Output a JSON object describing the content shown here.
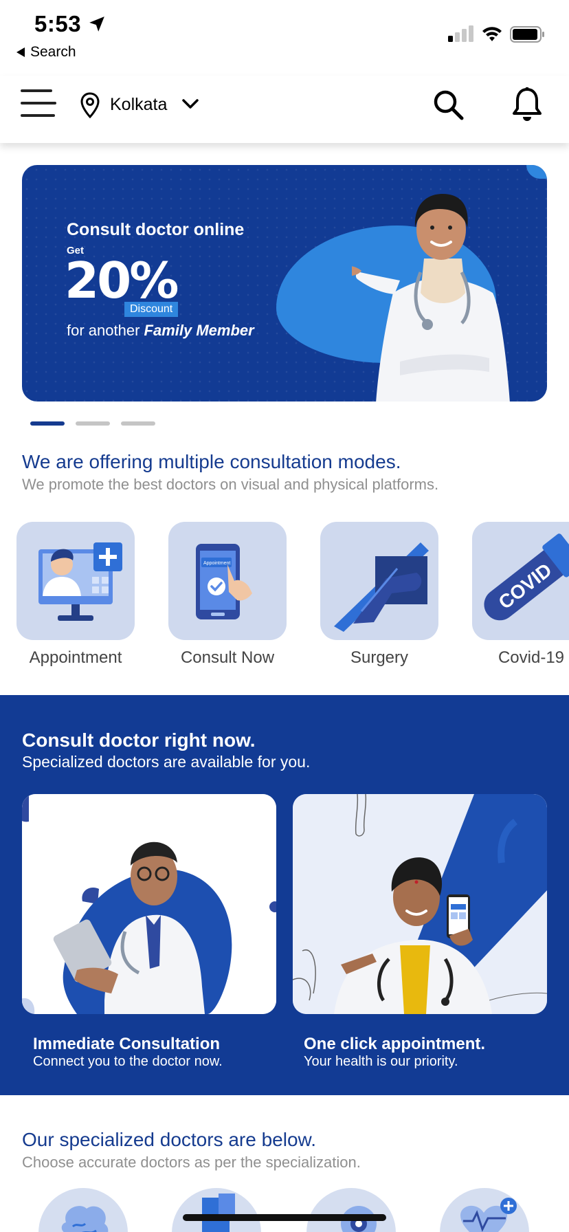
{
  "status_bar": {
    "time": "5:53",
    "back_label": "Search"
  },
  "header": {
    "location": "Kolkata"
  },
  "banner": {
    "title": "Consult doctor online",
    "get": "Get",
    "percent": "20%",
    "discount": "Discount",
    "family_prefix": "for another",
    "family_bold": "Family Member",
    "carousel_count": 3,
    "carousel_active": 0
  },
  "modes_section": {
    "title": "We are offering multiple consultation modes.",
    "subtitle": "We promote the best doctors on visual and physical platforms.",
    "items": [
      {
        "label": "Appointment",
        "icon": "appointment-monitor-icon"
      },
      {
        "label": "Consult Now",
        "icon": "phone-tap-icon"
      },
      {
        "label": "Surgery",
        "icon": "scalpel-hand-icon"
      },
      {
        "label": "Covid-19",
        "icon": "covid-test-tube-icon"
      }
    ]
  },
  "consult_section": {
    "title": "Consult doctor right now.",
    "subtitle": "Specialized doctors are available for you.",
    "cards": [
      {
        "title": "Immediate Consultation",
        "subtitle": "Connect you to the doctor now."
      },
      {
        "title": "One click appointment.",
        "subtitle": "Your health is our priority."
      }
    ]
  },
  "specialized_section": {
    "title": "Our specialized doctors are below.",
    "subtitle": "Choose accurate doctors as per the specialization."
  },
  "colors": {
    "brand_blue": "#123b94",
    "accent_blue": "#2f86de",
    "tile_bg": "#cfd9ee",
    "muted_text": "#8f8f8f"
  }
}
